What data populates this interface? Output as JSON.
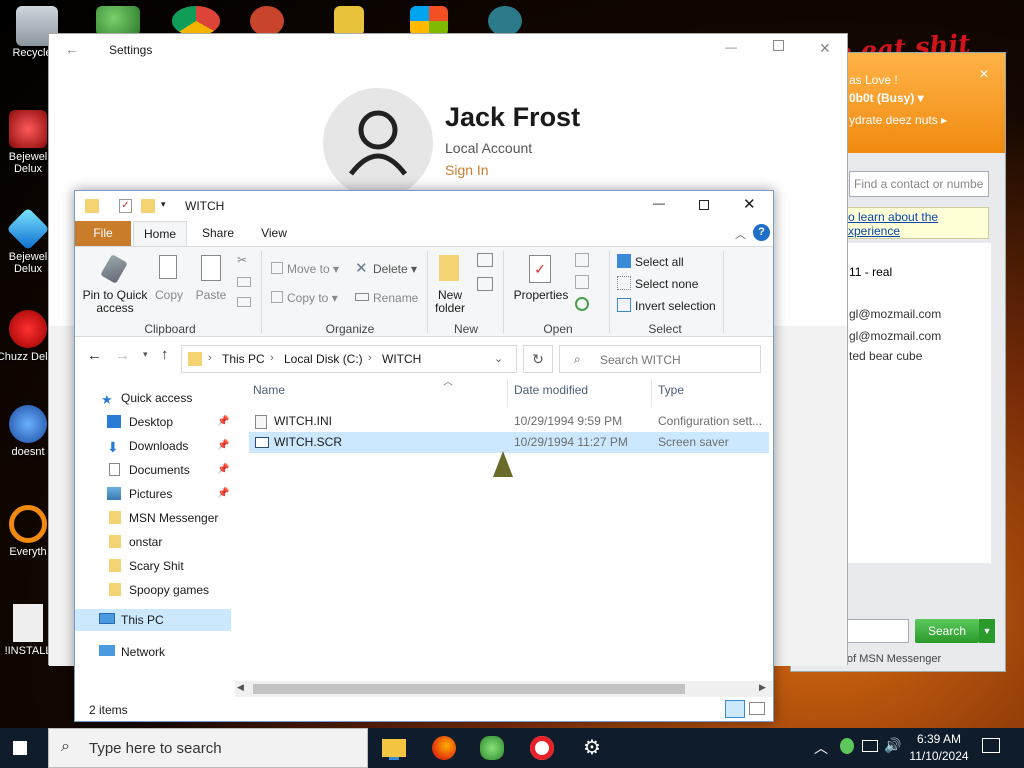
{
  "desktop": {
    "icons": [
      {
        "label": "Recycle"
      },
      {
        "label": "Bejewel Delux"
      },
      {
        "label": "Bejewel Delux"
      },
      {
        "label": "Chuzz Delux"
      },
      {
        "label": "doesnt"
      },
      {
        "label": "Everyth"
      },
      {
        "label": "!INSTALL"
      }
    ],
    "scrawl": "e eat shit"
  },
  "msn": {
    "header_lines": [
      "as Love !",
      "0b0t  (Busy) ▾",
      "ydrate deez nuts ▸"
    ],
    "search_placeholder": "Find a contact or numbe",
    "banner_lines": [
      "o learn about the",
      "xperience"
    ],
    "contacts": [
      "11 - real",
      "gl@mozmail.com",
      "gl@mozmail.com",
      "ted bear cube"
    ],
    "search_button": "Search",
    "footer": "of MSN Messenger"
  },
  "settings": {
    "title": "Settings",
    "user_name": "Jack Frost",
    "account_type": "Local Account",
    "sign_in": "Sign In"
  },
  "explorer": {
    "title": "WITCH",
    "tabs": {
      "file": "File",
      "home": "Home",
      "share": "Share",
      "view": "View"
    },
    "ribbon": {
      "pin": "Pin to Quick access",
      "copy": "Copy",
      "paste": "Paste",
      "clipboard": "Clipboard",
      "move_to": "Move to ▾",
      "copy_to": "Copy to ▾",
      "delete": "Delete ▾",
      "rename": "Rename",
      "organize": "Organize",
      "new_folder": "New folder",
      "new": "New",
      "properties": "Properties",
      "open": "Open",
      "select_all": "Select all",
      "select_none": "Select none",
      "invert_selection": "Invert selection",
      "select": "Select"
    },
    "path": [
      "This PC",
      "Local Disk (C:)",
      "WITCH"
    ],
    "search_placeholder": "Search WITCH",
    "nav": [
      {
        "label": "Quick access",
        "pinned": false
      },
      {
        "label": "Desktop",
        "pinned": true
      },
      {
        "label": "Downloads",
        "pinned": true
      },
      {
        "label": "Documents",
        "pinned": true
      },
      {
        "label": "Pictures",
        "pinned": true
      },
      {
        "label": "MSN Messenger",
        "pinned": false
      },
      {
        "label": "onstar",
        "pinned": false
      },
      {
        "label": "Scary Shit",
        "pinned": false
      },
      {
        "label": "Spoopy games",
        "pinned": false
      },
      {
        "label": "This PC",
        "pinned": false
      },
      {
        "label": "Network",
        "pinned": false
      }
    ],
    "columns": {
      "name": "Name",
      "date": "Date modified",
      "type": "Type"
    },
    "files": [
      {
        "name": "WITCH.INI",
        "date": "10/29/1994 9:59 PM",
        "type": "Configuration sett..."
      },
      {
        "name": "WITCH.SCR",
        "date": "10/29/1994 11:27 PM",
        "type": "Screen saver"
      }
    ],
    "status": "2 items"
  },
  "taskbar": {
    "search_placeholder": "Type here to search",
    "time": "6:39 AM",
    "date": "11/10/2024"
  },
  "colors": {
    "accent": "#0078d7",
    "file_tab": "#c97c2a",
    "selection": "#cce8ff",
    "search_btn": "#3aa83a"
  }
}
